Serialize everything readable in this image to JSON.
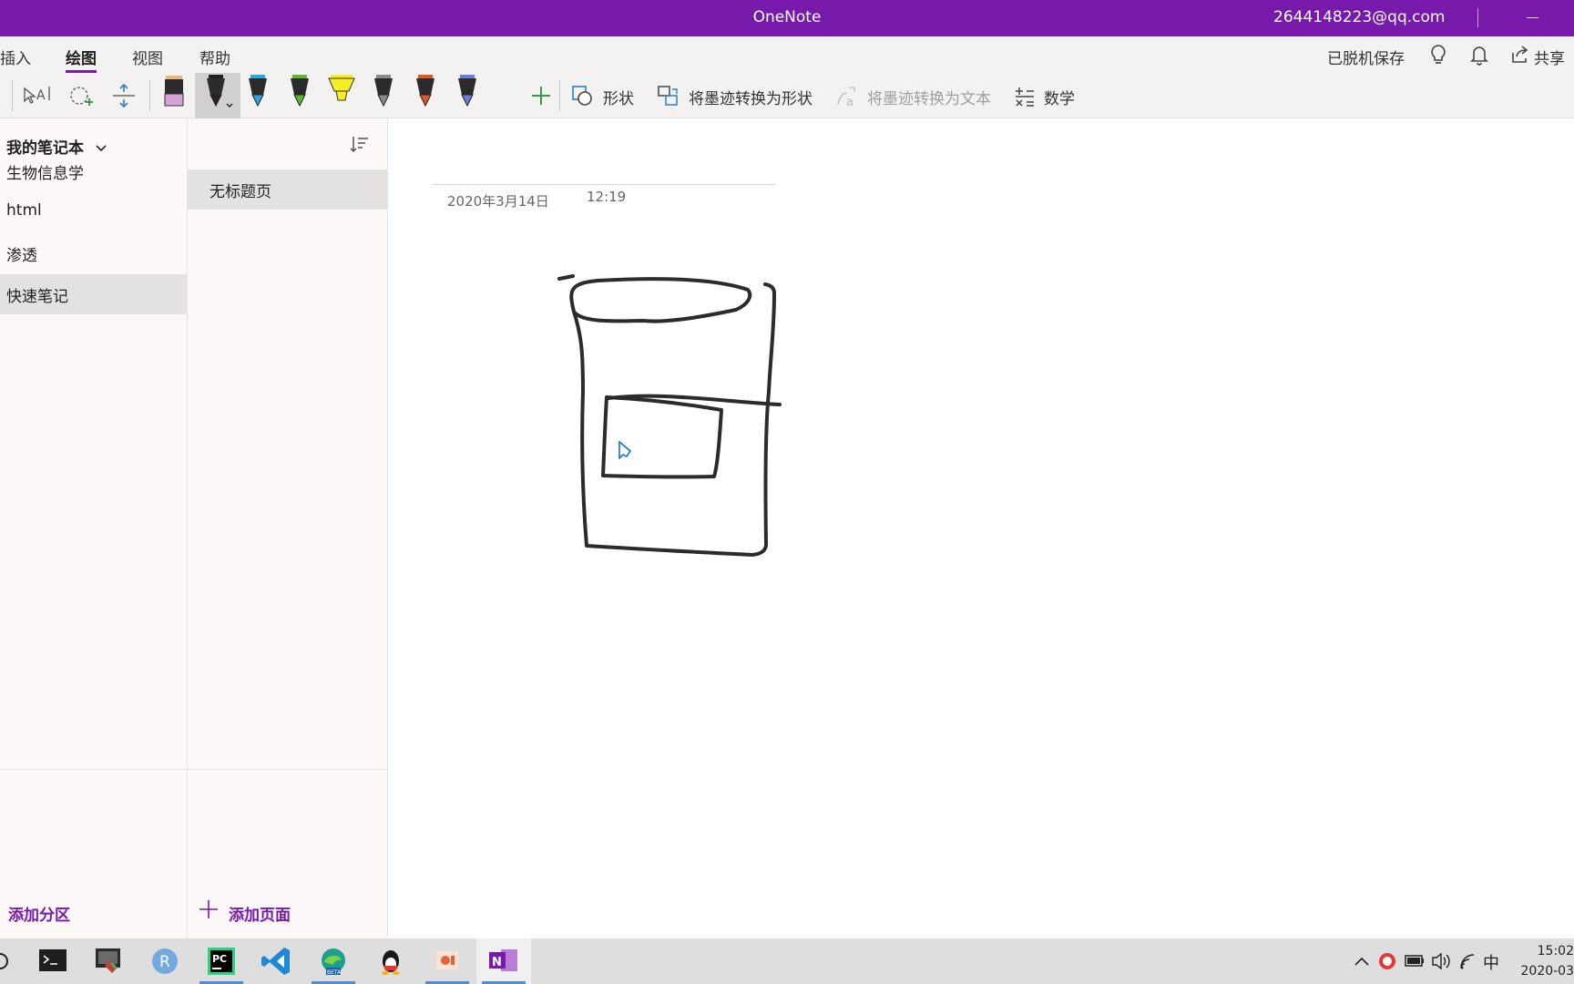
{
  "titlebar": {
    "app_title": "OneNote",
    "account": "2644148223@qq.com"
  },
  "menu": {
    "tabs": [
      {
        "label": "插入"
      },
      {
        "label": "绘图"
      },
      {
        "label": "视图"
      },
      {
        "label": "帮助"
      }
    ],
    "active_tab": "绘图",
    "offline_saved": "已脱机保存",
    "share": "共享"
  },
  "ribbon": {
    "pens": [
      {
        "name": "pink-eraser-pen",
        "color": "#d6a3d6"
      },
      {
        "name": "black-pen",
        "color": "#222222"
      },
      {
        "name": "blue-pen",
        "color": "#2aa7e0"
      },
      {
        "name": "green-pen",
        "color": "#5cb82e"
      },
      {
        "name": "yellow-highlighter",
        "color": "#f7ee25"
      },
      {
        "name": "galaxy-pen",
        "color": "#8a8a8a"
      },
      {
        "name": "red-orange-pen",
        "color": "#e0582a"
      },
      {
        "name": "galaxy-blue-pen",
        "color": "#6b7fd8"
      }
    ],
    "shapes_label": "形状",
    "ink_to_shape_label": "将墨迹转换为形状",
    "ink_to_text_label": "将墨迹转换为文本",
    "math_label": "数学"
  },
  "sections": {
    "notebook_title": "我的笔记本",
    "items": [
      {
        "label": "生物信息学"
      },
      {
        "label": "html"
      },
      {
        "label": "渗透"
      },
      {
        "label": "快速笔记"
      }
    ],
    "selected": "快速笔记",
    "add_label": "添加分区"
  },
  "pages": {
    "items": [
      {
        "label": "无标题页"
      }
    ],
    "add_label": "添加页面"
  },
  "page": {
    "date": "2020年3月14日",
    "time": "12:19"
  },
  "taskbar": {
    "apps": [
      "terminal",
      "app-tool",
      "r",
      "pycharm",
      "vscode",
      "edge-beta",
      "qq",
      "powerpoint",
      "onenote"
    ],
    "ime": "中",
    "clock_time": "15:02",
    "clock_date": "2020-03"
  },
  "colors": {
    "brand": "#7719AA",
    "ribbon_bg": "#f3f2f1",
    "pane_bg": "#fcf8f8"
  }
}
